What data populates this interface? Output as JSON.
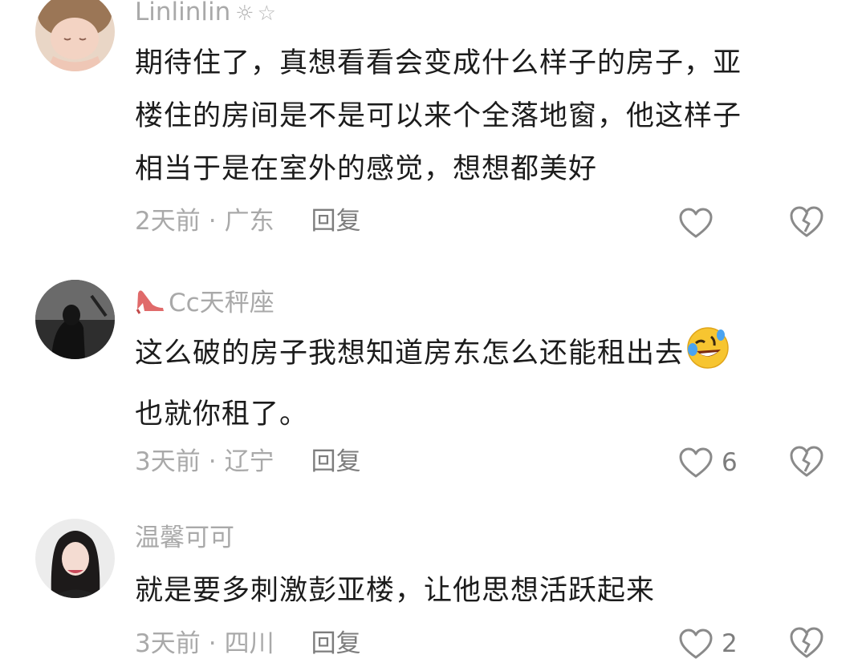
{
  "comments": [
    {
      "username": "Linlinlin",
      "username_deco": "☼☆",
      "lines": [
        "期待住了，真想看看会变成什么样子的房子，亚",
        "楼住的房间是不是可以来个全落地窗，他这样子",
        "相当于是在室外的感觉，想想都美好"
      ],
      "time": "2天前",
      "location": "广东",
      "reply_label": "回复",
      "like_count": ""
    },
    {
      "username": "Cc天秤座",
      "username_icon": "high-heel-icon",
      "lines": [
        "这么破的房子我想知道房东怎么还能租出去",
        "也就你租了。"
      ],
      "line_emoji": "rolling-on-floor-laughing-icon",
      "time": "3天前",
      "location": "辽宁",
      "reply_label": "回复",
      "like_count": "6"
    },
    {
      "username": "温馨可可",
      "lines": [
        "就是要多刺激彭亚楼，让他思想活跃起来"
      ],
      "time": "3天前",
      "location": "四川",
      "reply_label": "回复",
      "like_count": "2"
    }
  ],
  "separator": "·",
  "colors": {
    "text": "#1c1c1c",
    "muted": "#a9a9a9",
    "reply": "#7d7d7d",
    "icon_stroke": "#8a8a8a"
  }
}
